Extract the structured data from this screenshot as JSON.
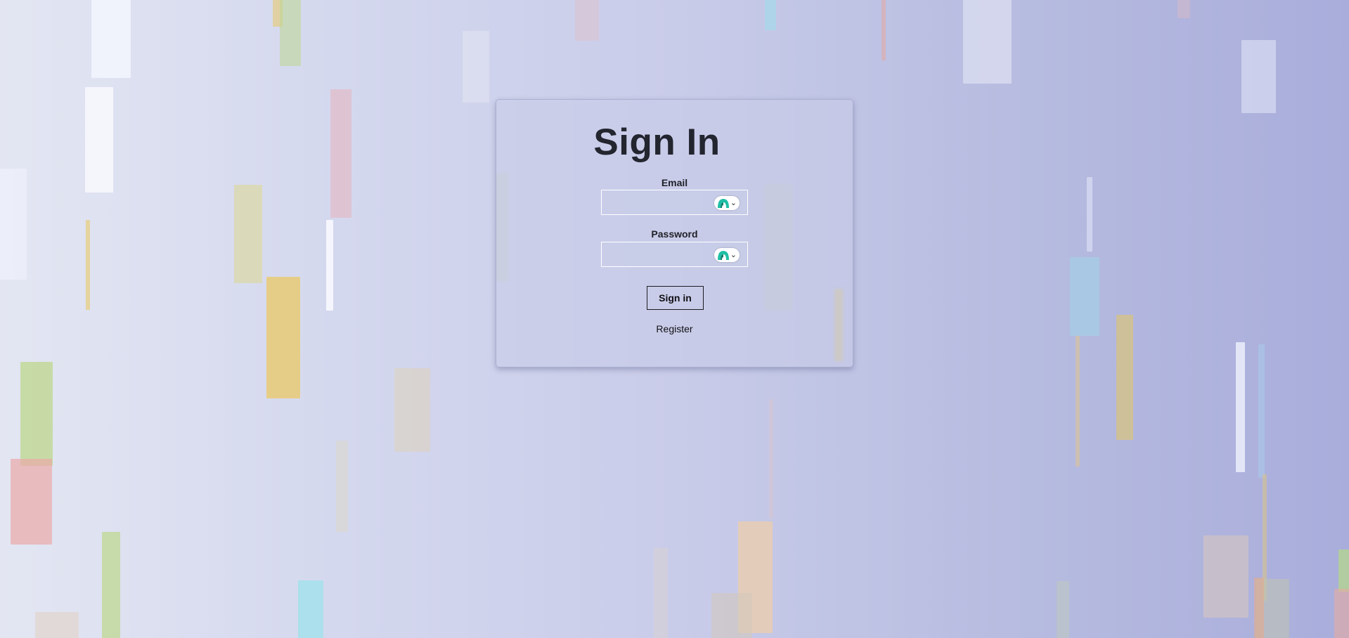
{
  "login": {
    "title": "Sign In",
    "email_label": "Email",
    "email_value": "",
    "password_label": "Password",
    "password_value": "",
    "submit_label": "Sign in",
    "register_label": "Register"
  },
  "colors": {
    "background_left": "#e3e6f2",
    "background_right": "#a9addb",
    "title_text": "#23252f",
    "password_manager_accent": "#1fbfa5"
  },
  "icons": {
    "password_manager": "password-manager-icon",
    "dropdown": "chevron-down-icon"
  }
}
